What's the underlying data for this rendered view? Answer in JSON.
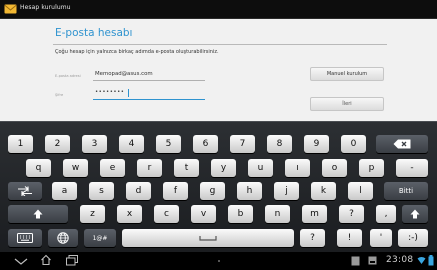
{
  "header": {
    "title": "Hesap kurulumu",
    "app_icon": "envelope-icon",
    "app_icon_color": "#f2b833"
  },
  "form": {
    "heading": "E-posta hesabı",
    "description": "Çoğu hesap için yalnızca birkaç adımda e-posta oluşturabilirsiniz.",
    "email_label": "E-posta adresi",
    "email_value": "Memopad@asus.com",
    "password_label": "Şifre",
    "password_value": "••••••••",
    "manual_button": "Manuel kurulum",
    "next_button": "İleri",
    "accent_color": "#2f93cf"
  },
  "keyboard": {
    "row1": [
      "1",
      "2",
      "3",
      "4",
      "5",
      "6",
      "7",
      "8",
      "9",
      "0"
    ],
    "row2": [
      "q",
      "w",
      "e",
      "r",
      "t",
      "y",
      "u",
      "ı",
      "o",
      "p",
      "-"
    ],
    "row3": [
      "a",
      "s",
      "d",
      "f",
      "g",
      "h",
      "j",
      "k",
      "l"
    ],
    "done_label": "Bitti",
    "row4": [
      "z",
      "x",
      "c",
      "v",
      "b",
      "n",
      "m",
      "?",
      ","
    ],
    "row5": [
      "1@#",
      "?",
      "!",
      "'",
      ":-)"
    ],
    "icons": [
      "backspace-icon",
      "tab-icon",
      "shift-icon",
      "keyboard-settings-icon",
      "globe-icon",
      "space-icon"
    ]
  },
  "navbar": {
    "time": "23:08",
    "icons": [
      "back-icon",
      "home-icon",
      "recent-apps-icon",
      "screenshot-icon",
      "sd-card-icon",
      "wifi-icon",
      "battery-icon"
    ]
  }
}
